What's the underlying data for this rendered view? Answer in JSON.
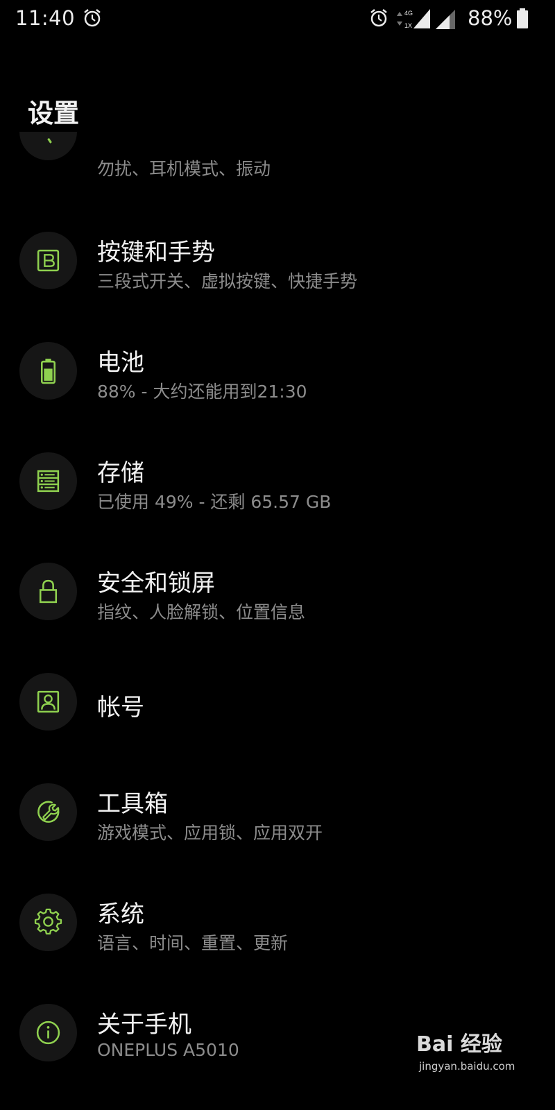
{
  "status_bar": {
    "time": "11:40",
    "battery_percent_text": "88%",
    "network_type_top": "4G",
    "network_type_bottom": "1X",
    "battery_level": 0.88,
    "icons": [
      "alarm-clock-icon",
      "alarm-clock-icon",
      "data-arrows-icon",
      "signal-icon",
      "signal-icon",
      "battery-icon"
    ]
  },
  "header": {
    "title": "设置"
  },
  "partial_item": {
    "subtitle": "勿扰、耳机模式、振动"
  },
  "settings": [
    {
      "title": "按键和手势",
      "subtitle": "三段式开关、虚拟按键、快捷手势",
      "icon": "buttons-icon"
    },
    {
      "title": "电池",
      "subtitle": "88% - 大约还能用到21:30",
      "icon": "battery-icon"
    },
    {
      "title": "存储",
      "subtitle": "已使用 49% - 还剩 65.57 GB",
      "icon": "storage-icon"
    },
    {
      "title": "安全和锁屏",
      "subtitle": "指纹、人脸解锁、位置信息",
      "icon": "lock-icon"
    },
    {
      "title": "帐号",
      "subtitle": "",
      "icon": "account-icon"
    },
    {
      "title": "工具箱",
      "subtitle": "游戏模式、应用锁、应用双开",
      "icon": "toolbox-icon"
    },
    {
      "title": "系统",
      "subtitle": "语言、时间、重置、更新",
      "icon": "gear-icon"
    },
    {
      "title": "关于手机",
      "subtitle": "ONEPLUS A5010",
      "icon": "info-icon"
    }
  ],
  "theme": {
    "accent": "#8fd14f",
    "background": "#000000",
    "icon_bg": "#161616",
    "title_color": "#f2f2f2",
    "subtitle_color": "#8c8c8c"
  },
  "watermark": {
    "logo": "Bai 经验",
    "url": "jingyan.baidu.com"
  }
}
